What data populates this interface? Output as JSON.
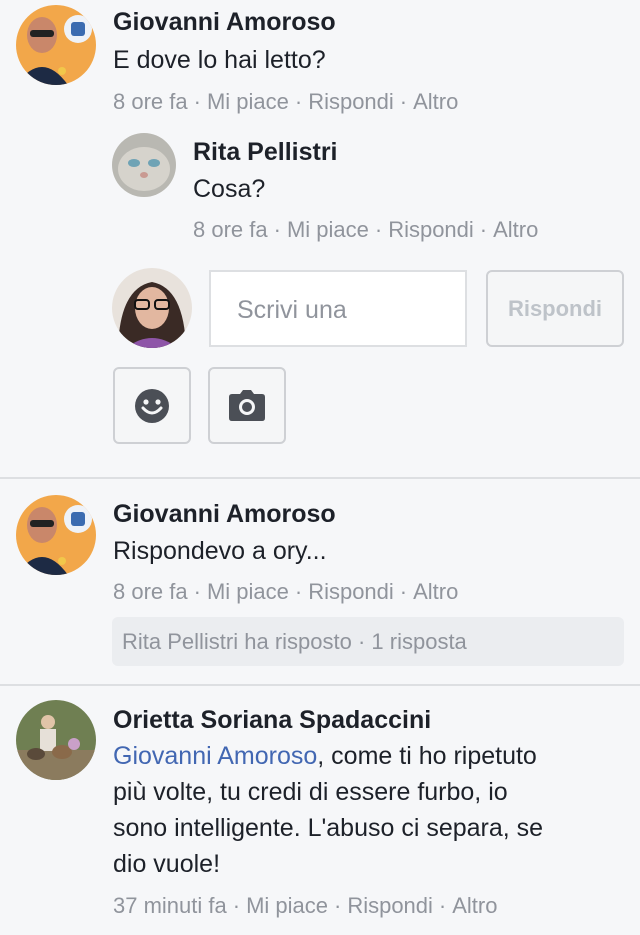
{
  "comments": [
    {
      "author": "Giovanni Amoroso",
      "text": "E dove lo hai letto?",
      "time": "8 ore fa",
      "like": "Mi piace",
      "reply": "Rispondi",
      "more": "Altro"
    },
    {
      "author": "Rita Pellistri",
      "text": "Cosa?",
      "time": "8 ore fa",
      "like": "Mi piace",
      "reply": "Rispondi",
      "more": "Altro"
    },
    {
      "author": "Giovanni Amoroso",
      "text": "Rispondevo a ory...",
      "time": "8 ore fa",
      "like": "Mi piace",
      "reply": "Rispondi",
      "more": "Altro"
    },
    {
      "author": "Orietta Soriana Spadaccini",
      "mention": "Giovanni Amoroso",
      "text_line1": ", come ti ho ripetuto",
      "text_line2": "più volte, tu credi di essere furbo, io",
      "text_line3": "sono intelligente. L'abuso ci separa, se",
      "text_line4": "dio vuole!",
      "time": "37 minuti fa",
      "like": "Mi piace",
      "reply": "Rispondi",
      "more": "Altro"
    }
  ],
  "composer": {
    "placeholder": "Scrivi una",
    "submit_label": "Rispondi",
    "emoji_icon": "smiley-icon",
    "camera_icon": "camera-icon"
  },
  "replies_summary": "Rita Pellistri ha risposto · 1 risposta",
  "separator": "·",
  "colors": {
    "background": "#f6f7f9",
    "text": "#1d2129",
    "meta": "#90949c",
    "mention": "#4267b2",
    "icon": "#4b4f56"
  }
}
